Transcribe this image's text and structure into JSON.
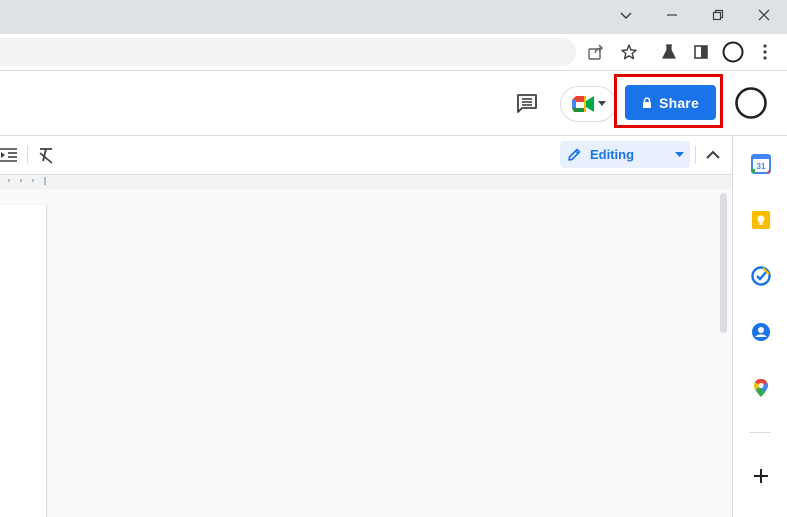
{
  "window": {
    "controls": [
      "minimize-icon",
      "restore-icon",
      "close-icon",
      "tab-search-icon"
    ]
  },
  "toolbar_icons": [
    "share-page-icon",
    "bookmark-star-icon",
    "labs-flask-icon",
    "side-panel-icon",
    "profile-avatar-icon",
    "menu-dots-icon"
  ],
  "doc_header": {
    "share_label": "Share",
    "icons": [
      "comment-history-icon",
      "meet-icon",
      "account-avatar-icon"
    ]
  },
  "doc_toolbar": {
    "editing_label": "Editing",
    "icons": [
      "indent-icon",
      "clear-formatting-icon",
      "pencil-icon",
      "dropdown-arrow-icon",
      "collapse-chevron-icon"
    ]
  },
  "side_panel": {
    "calendar_day": "31",
    "icons": [
      "calendar-icon",
      "keep-icon",
      "tasks-icon",
      "contacts-icon",
      "maps-icon",
      "add-icon"
    ]
  },
  "colors": {
    "share_blue": "#1a73e8",
    "highlight_red": "#e00000",
    "editing_bg": "#e8f0fe"
  }
}
